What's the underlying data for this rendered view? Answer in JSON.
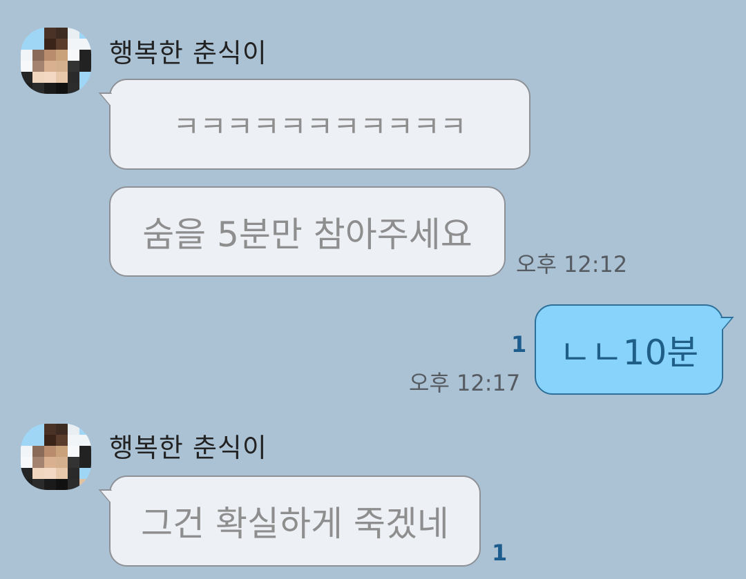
{
  "messages": [
    {
      "sender": "행복한 춘식이",
      "bubbles": [
        {
          "text": "ㅋㅋㅋㅋㅋㅋㅋㅋㅋㅋㅋ"
        },
        {
          "text": "숨을 5분만 참아주세요",
          "time": "오후 12:12"
        }
      ]
    },
    {
      "sender": "me",
      "bubbles": [
        {
          "text": "ㄴㄴ10분",
          "time": "오후 12:17",
          "unread": "1"
        }
      ]
    },
    {
      "sender": "행복한 춘식이",
      "bubbles": [
        {
          "text": "그건 확실하게 죽겠네",
          "unread": "1"
        }
      ]
    }
  ],
  "colors": {
    "background": "#abc1d4",
    "other_bubble": "#edf0f5",
    "my_bubble": "#87d3fb",
    "unread": "#1d5d8e"
  },
  "icons": [
    "profile-avatar"
  ]
}
